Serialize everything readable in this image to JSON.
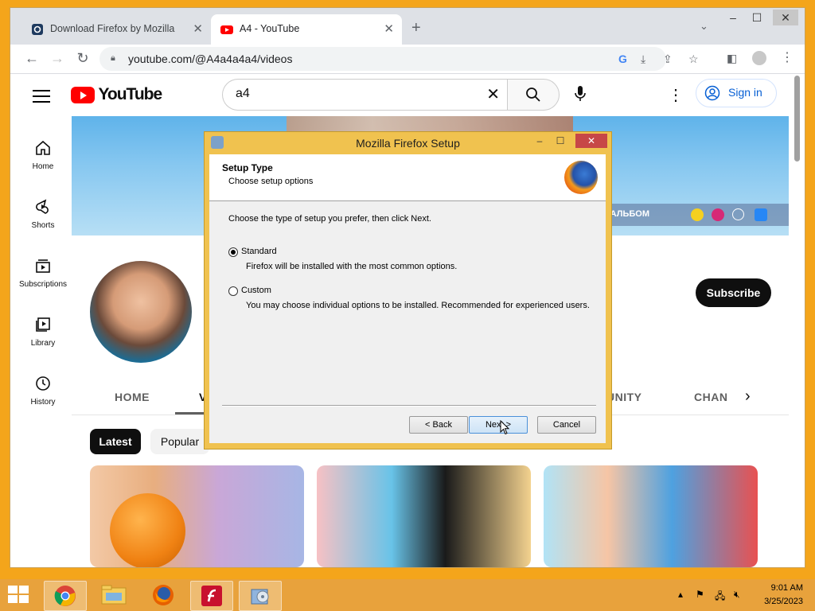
{
  "browser": {
    "tabs": [
      {
        "title": "Download Firefox by Mozilla",
        "icon": "firefox-download-favicon"
      },
      {
        "title": "A4 - YouTube",
        "icon": "youtube-favicon"
      }
    ],
    "url": "youtube.com/@A4a4a4a4/videos"
  },
  "youtube": {
    "logo_text": "YouTube",
    "search_value": "a4",
    "signin_label": "Sign in",
    "guide": [
      {
        "label": "Home",
        "icon": "home-icon"
      },
      {
        "label": "Shorts",
        "icon": "shorts-icon"
      },
      {
        "label": "Subscriptions",
        "icon": "subscriptions-icon"
      },
      {
        "label": "Library",
        "icon": "library-icon"
      },
      {
        "label": "History",
        "icon": "history-icon"
      }
    ],
    "banner_text": "МОЙ АЛЬБОМ",
    "subscribe_label": "Subscribe",
    "channel_tabs": {
      "home": "HOME",
      "videos": "V",
      "community": "UNITY",
      "channels": "CHAN"
    },
    "chips": {
      "latest": "Latest",
      "popular": "Popular"
    }
  },
  "dialog": {
    "title": "Mozilla Firefox Setup",
    "header_title": "Setup Type",
    "header_subtitle": "Choose setup options",
    "prompt": "Choose the type of setup you prefer, then click Next.",
    "options": [
      {
        "label": "Standard",
        "description": "Firefox will be installed with the most common options.",
        "selected": true
      },
      {
        "label": "Custom",
        "description": "You may choose individual options to be installed. Recommended for experienced users.",
        "selected": false
      }
    ],
    "buttons": {
      "back": "< Back",
      "next": "Next >",
      "cancel": "Cancel"
    }
  },
  "taskbar": {
    "time": "9:01 AM",
    "date": "3/25/2023",
    "apps": [
      "chrome-icon",
      "file-explorer-icon",
      "firefox-icon",
      "flash-icon",
      "installer-icon"
    ]
  },
  "colors": {
    "accent": "#f4a51b",
    "yt_red": "#ff0000",
    "link_blue": "#065fd4",
    "dialog_frame": "#f0c24f"
  }
}
